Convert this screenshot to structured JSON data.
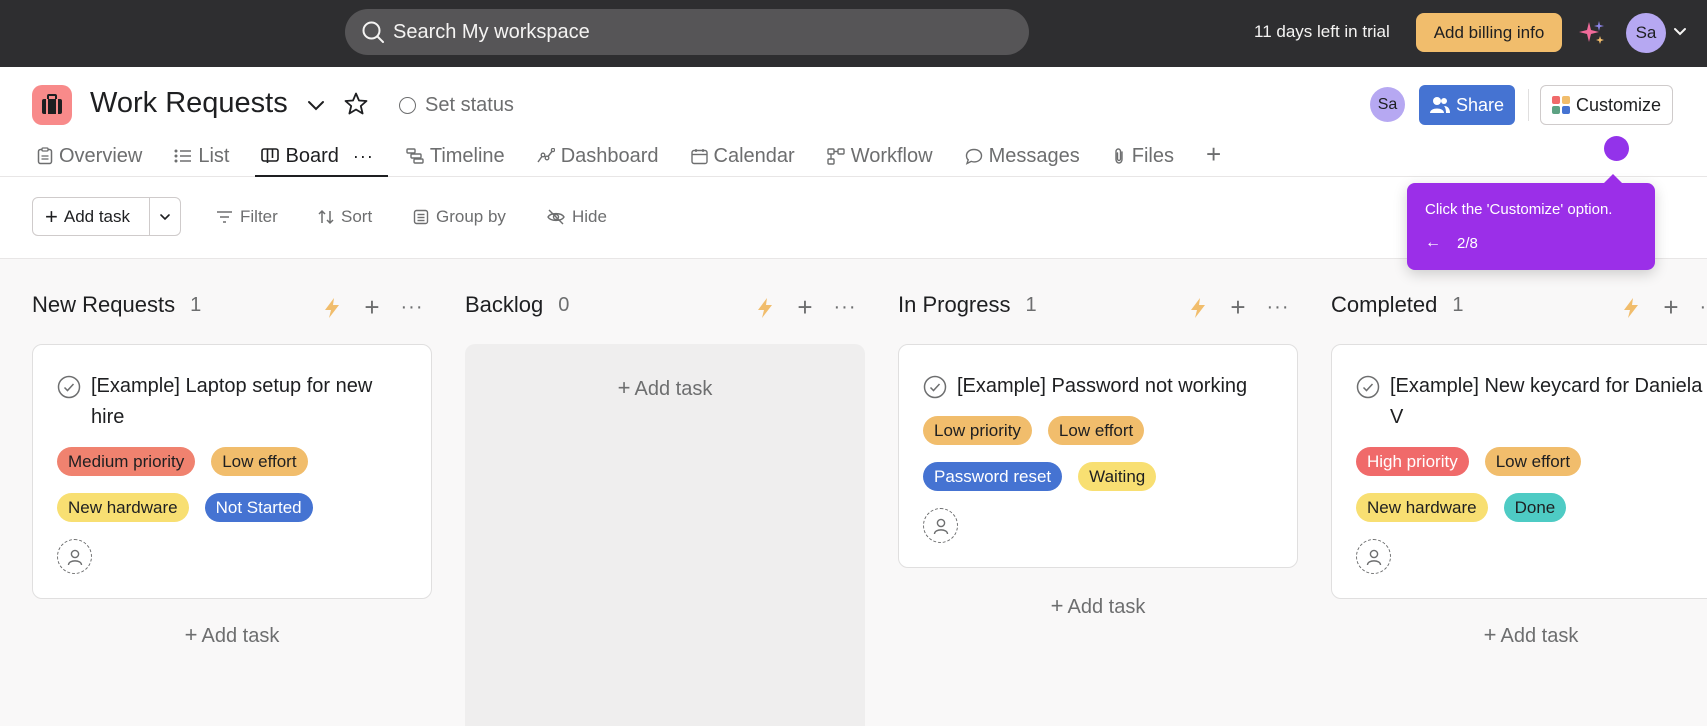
{
  "topbar": {
    "search_placeholder": "Search My workspace",
    "trial_text": "11 days left in trial",
    "billing_label": "Add billing info",
    "avatar_initials": "Sa"
  },
  "header": {
    "title": "Work Requests",
    "set_status": "Set status",
    "avatar_initials": "Sa",
    "share_label": "Share",
    "customize_label": "Customize",
    "project_color": "#f88a8a"
  },
  "tabs": [
    {
      "label": "Overview"
    },
    {
      "label": "List"
    },
    {
      "label": "Board",
      "more": "···"
    },
    {
      "label": "Timeline"
    },
    {
      "label": "Dashboard"
    },
    {
      "label": "Calendar"
    },
    {
      "label": "Workflow"
    },
    {
      "label": "Messages"
    },
    {
      "label": "Files"
    }
  ],
  "toolbar": {
    "add_task": "Add task",
    "filter": "Filter",
    "sort": "Sort",
    "group_by": "Group by",
    "hide": "Hide"
  },
  "tooltip": {
    "message": "Click the 'Customize' option.",
    "step": "2/8",
    "color": "#9b2fe8"
  },
  "columns": [
    {
      "title": "New Requests",
      "count": "1",
      "add_task": "Add task",
      "card": {
        "title": "[Example] Laptop setup for new hire",
        "tags_row1": [
          {
            "label": "Medium priority",
            "color": "#f0826f"
          },
          {
            "label": "Low effort",
            "color": "#f1bd6c"
          }
        ],
        "tags_row2": [
          {
            "label": "New hardware",
            "color": "#f8df72"
          },
          {
            "label": "Not Started",
            "color": "#4573d2"
          }
        ]
      }
    },
    {
      "title": "Backlog",
      "count": "0",
      "add_task": "Add task"
    },
    {
      "title": "In Progress",
      "count": "1",
      "add_task": "Add task",
      "card": {
        "title": "[Example] Password not working",
        "tags_row1": [
          {
            "label": "Low priority",
            "color": "#f1bd6c"
          },
          {
            "label": "Low effort",
            "color": "#f1bd6c"
          }
        ],
        "tags_row2": [
          {
            "label": "Password reset",
            "color": "#4573d2"
          },
          {
            "label": "Waiting",
            "color": "#f8df72"
          }
        ]
      }
    },
    {
      "title": "Completed",
      "count": "1",
      "add_task": "Add task",
      "card": {
        "title": "[Example] New keycard for Daniela V",
        "tags_row1": [
          {
            "label": "High priority",
            "color": "#f06a6a"
          },
          {
            "label": "Low effort",
            "color": "#f1bd6c"
          }
        ],
        "tags_row2": [
          {
            "label": "New hardware",
            "color": "#f8df72"
          },
          {
            "label": "Done",
            "color": "#4ecbc4"
          }
        ]
      }
    }
  ]
}
